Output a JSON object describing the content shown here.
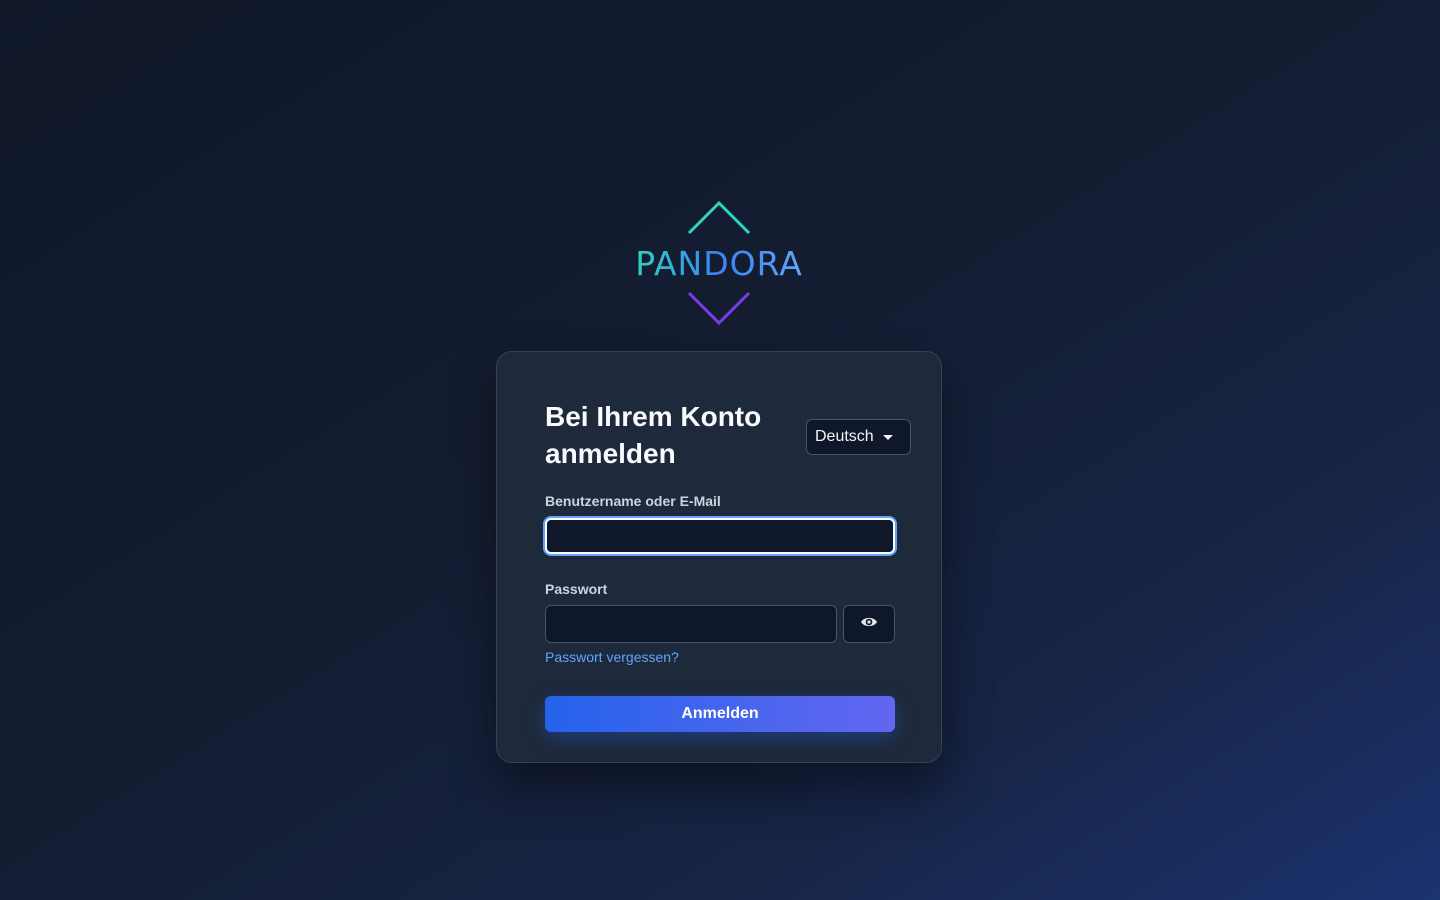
{
  "brand": {
    "name": "PANDORA",
    "colors": {
      "teal": "#2dd4bf",
      "blue": "#3b82f6",
      "purple": "#7c3aed"
    }
  },
  "login": {
    "title": "Bei Ihrem Konto anmelden",
    "language": {
      "selected": "Deutsch",
      "icon": "caret-down-icon"
    },
    "username": {
      "label": "Benutzername oder E-Mail",
      "value": ""
    },
    "password": {
      "label": "Passwort",
      "value": "",
      "toggle_icon": "eye-icon"
    },
    "forgot_link": "Passwort vergessen?",
    "submit_label": "Anmelden"
  },
  "colors": {
    "accent": "#2563eb",
    "accent_end": "#6366f1",
    "link": "#60a5fa",
    "card_bg": "#1e293b",
    "focus_ring": "#60a5fa"
  }
}
